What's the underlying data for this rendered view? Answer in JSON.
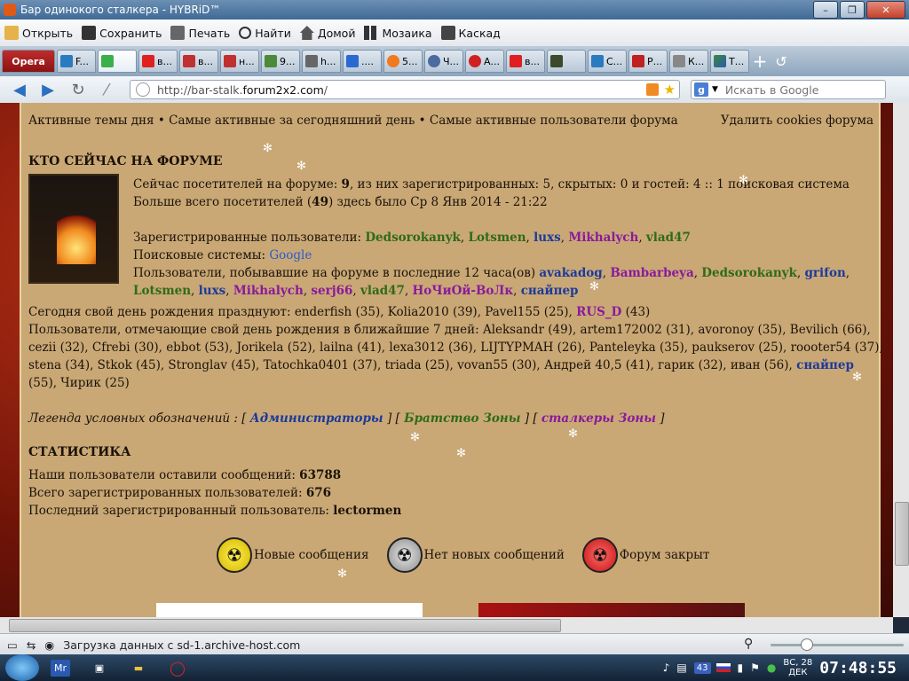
{
  "window": {
    "title": "Бар одинокого сталкера - HYBRiD™"
  },
  "menu": {
    "open": "Открыть",
    "save": "Сохранить",
    "print": "Печать",
    "find": "Найти",
    "home": "Домой",
    "mosaic": "Мозаика",
    "cascade": "Каскад"
  },
  "tabs": {
    "opera": "Opera",
    "items": [
      "F...",
      "",
      "в...",
      "в...",
      "н...",
      "9...",
      "h...",
      "....",
      "5...",
      "Ч...",
      "А...",
      "в...",
      "",
      "С...",
      "Р...",
      "К...",
      "Т..."
    ]
  },
  "address": {
    "url_prefix": "http://bar-stalk.",
    "url_domain": "forum2x2.com",
    "url_suffix": "/",
    "search_placeholder": "Искать в Google",
    "search_engine": "g"
  },
  "forum": {
    "toplinks": "Активные темы дня • Самые активные за сегодняшний день • Самые активные пользователи форума",
    "delete_cookies": "Удалить cookies форума",
    "who_online_title": "КТО СЕЙЧАС НА ФОРУМЕ",
    "visitors_pre": "Сейчас посетителей на форуме: ",
    "visitors_count": "9",
    "visitors_post": ", из них зарегистрированных: 5, скрытых: 0 и гостей: 4 :: 1 поисковая система",
    "max_pre": "Больше всего посетителей (",
    "max_count": "49",
    "max_post": ") здесь было Ср 8 Янв 2014 - 21:22",
    "registered_label": "Зарегистрированные пользователи:",
    "registered_users": [
      {
        "name": "Dedsorokanyk",
        "group": "green"
      },
      {
        "name": "Lotsmen",
        "group": "green"
      },
      {
        "name": "luxs",
        "group": "blue"
      },
      {
        "name": "Mikhalych",
        "group": "purple"
      },
      {
        "name": "vlad47",
        "group": "green"
      }
    ],
    "search_engines_label": "Поисковые системы:",
    "search_engine_name": "Google",
    "last12_label": "Пользователи, побывавшие на форуме в последние 12 часа(ов)",
    "last12_users": [
      "avakadog",
      "Bambarbeya",
      "Dedsorokanyk",
      "grifon",
      "Lotsmen",
      "luxs",
      "Mikhalych",
      "serj66",
      "vlad47",
      "НоЧиОй-ВоЛк",
      "снайпер"
    ],
    "birthday_today_pre": "Сегодня свой день рождения празднуют: enderfish (35), Kolia2010 (39), Pavel155 (25), ",
    "birthday_today_user": "RUS_D",
    "birthday_today_post": " (43)",
    "birthday_week_l1": "Пользователи, отмечающие свой день рождения в ближайшие 7 дней: Aleksandr (49), artem172002 (31), avoronoy (35), Bevilich (66),",
    "birthday_week_l2": "cezii (32), Cfrebi (30), ebbot (53), Jorikela (52), lailna (41), lexa3012 (36), LIJTYPMAH (26), Panteleyka (35), paukserov (25), roooter54 (37),",
    "birthday_week_l3_pre": "stena (34), Stkok (45), Stronglav (45), Tatochka0401 (37), triada (25), vovan55 (30), Андрей 40,5 (41), гарик (32), иван (56), ",
    "birthday_week_l3_user": "снайпер",
    "birthday_week_l4": "(55), Чирик (25)",
    "legend_label": "Легенда условных обозначений :",
    "legend_admins": "Администраторы",
    "legend_brotherhood": "Братство Зоны",
    "legend_stalkers": "сталкеры Зоны",
    "stats_title": "СТАТИСТИКА",
    "stats_posts_label": "Наши пользователи оставили сообщений: ",
    "stats_posts": "63788",
    "stats_users_label": "Всего зарегистрированных пользователей: ",
    "stats_users": "676",
    "stats_last_label": "Последний зарегистрированный пользователь: ",
    "stats_last": "lectormen",
    "icon_new": "Новые сообщения",
    "icon_nonew": "Нет новых сообщений",
    "icon_closed": "Форум закрыт"
  },
  "status": {
    "text": "Загрузка данных с sd-1.archive-host.com"
  },
  "taskbar": {
    "mr": "Mr",
    "badge": "43",
    "date_day": "ВС, 28",
    "date_month": "ДЕК",
    "time": "07:48:55"
  },
  "colors": {
    "green": "#2f6a1a",
    "blue": "#1d3a9a",
    "purple": "#8a1a9a"
  }
}
